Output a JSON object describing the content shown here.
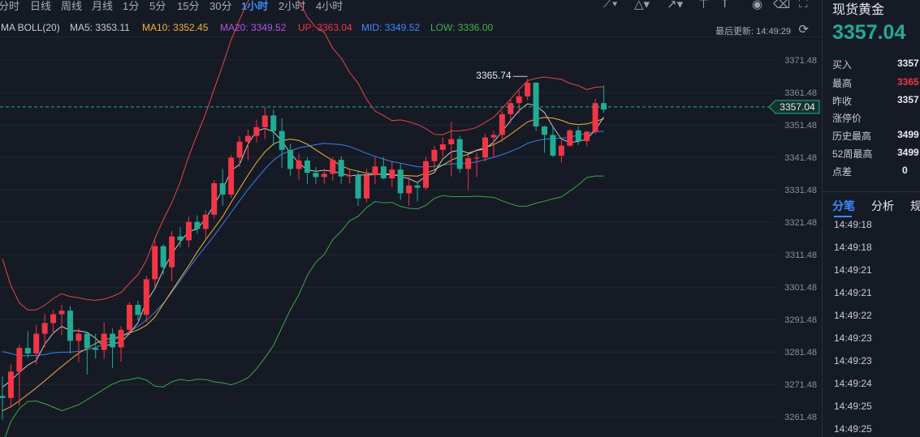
{
  "periods": [
    "分时",
    "日线",
    "周线",
    "月线",
    "1分",
    "5分",
    "15分",
    "30分",
    "1小时",
    "2小时",
    "4小时"
  ],
  "active_period": "1小时",
  "tools": [
    {
      "name": "line-draw-icon",
      "glyph": "⟋"
    },
    {
      "name": "shape-draw-icon",
      "glyph": "△"
    },
    {
      "name": "arrow-draw-icon",
      "glyph": "↗"
    },
    {
      "name": "pin-icon",
      "glyph": "⊤"
    },
    {
      "name": "text-icon",
      "glyph": "T"
    },
    {
      "name": "eye-icon",
      "glyph": "◉"
    },
    {
      "name": "trash-icon",
      "glyph": "🗑"
    },
    {
      "name": "fullscreen-icon",
      "glyph": "⛶"
    }
  ],
  "indicators": {
    "name": "MA BOLL(20)",
    "ma5": "MA5: 3353.11",
    "ma10": "MA10: 3352.45",
    "ma20": "MA20: 3349.52",
    "up": "UP: 3363.04",
    "mid": "MID: 3349.52",
    "low": "LOW: 3336.00"
  },
  "last_update_label": "最后更新: 14:49:29",
  "colors": {
    "up": "#f23645",
    "down": "#22ab94",
    "ma5": "#c9c9c9",
    "ma10": "#f3b432",
    "mid": "#3a7ff0",
    "upband": "#e04848",
    "lowband": "#3fa545",
    "grid": "#222838",
    "bg": "#161a25"
  },
  "sidebar": {
    "title": "现货黄金",
    "price": "3357.04",
    "rows": [
      {
        "label": "买入",
        "value": "3357"
      },
      {
        "label": "最高",
        "value": "3365"
      },
      {
        "label": "昨收",
        "value": "3357"
      },
      {
        "label": "涨停价",
        "value": ""
      },
      {
        "label": "历史最高",
        "value": "3499"
      },
      {
        "label": "52周最高",
        "value": "3499"
      },
      {
        "label": "点差",
        "value": "0"
      }
    ],
    "tabs": [
      "分笔",
      "分析",
      "规"
    ],
    "ticks": [
      "14:49:18",
      "14:49:18",
      "14:49:21",
      "14:49:21",
      "14:49:22",
      "14:49:23",
      "14:49:23",
      "14:49:24",
      "14:49:25",
      "14:49:25"
    ]
  },
  "chart_data": {
    "type": "candlestick",
    "ylim": [
      3256.5,
      3376
    ],
    "y_ticks": [
      "3371.48",
      "3361.48",
      "3351.48",
      "3341.48",
      "3331.48",
      "3321.48",
      "3311.48",
      "3301.48",
      "3291.48",
      "3281.48",
      "3271.48",
      "3261.48"
    ],
    "current_price": "3357.04",
    "max_annotation": "3365.74",
    "candles": [
      [
        3267.9,
        3273.9,
        3260.6,
        3267.3
      ],
      [
        3267.3,
        3277.6,
        3264.3,
        3275.4
      ],
      [
        3275.4,
        3283.7,
        3264.9,
        3282.7
      ],
      [
        3282.7,
        3287.9,
        3279.6,
        3281.0
      ],
      [
        3281.0,
        3289.8,
        3277.6,
        3287.1
      ],
      [
        3287.1,
        3293.3,
        3282.9,
        3290.4
      ],
      [
        3290.4,
        3294.4,
        3287.1,
        3293.1
      ],
      [
        3293.1,
        3296.0,
        3286.7,
        3294.2
      ],
      [
        3294.2,
        3295.6,
        3281.0,
        3284.9
      ],
      [
        3284.9,
        3288.7,
        3278.3,
        3287.1
      ],
      [
        3287.1,
        3287.5,
        3274.5,
        3282.7
      ],
      [
        3282.7,
        3287.1,
        3279.4,
        3282.1
      ],
      [
        3282.1,
        3290.6,
        3279.4,
        3287.1
      ],
      [
        3287.1,
        3288.7,
        3276.5,
        3282.9
      ],
      [
        3282.9,
        3289.4,
        3278.5,
        3288.3
      ],
      [
        3288.3,
        3296.8,
        3286.7,
        3296.0
      ],
      [
        3296.0,
        3297.3,
        3291.3,
        3292.9
      ],
      [
        3292.9,
        3304.9,
        3290.6,
        3303.9
      ],
      [
        3303.9,
        3316.3,
        3301.5,
        3314.1
      ],
      [
        3314.1,
        3314.7,
        3305.3,
        3307.6
      ],
      [
        3307.6,
        3318.8,
        3303.3,
        3317.1
      ],
      [
        3317.1,
        3320.0,
        3313.7,
        3315.9
      ],
      [
        3315.9,
        3323.2,
        3313.7,
        3321.6
      ],
      [
        3321.6,
        3323.6,
        3317.9,
        3319.4
      ],
      [
        3319.4,
        3325.2,
        3316.5,
        3323.8
      ],
      [
        3323.8,
        3334.5,
        3322.6,
        3333.5
      ],
      [
        3333.5,
        3337.9,
        3326.5,
        3330.0
      ],
      [
        3330.0,
        3342.2,
        3329.0,
        3341.4
      ],
      [
        3341.4,
        3348.1,
        3338.5,
        3346.3
      ],
      [
        3346.3,
        3350.0,
        3340.7,
        3348.1
      ],
      [
        3348.1,
        3353.1,
        3346.1,
        3350.8
      ],
      [
        3350.8,
        3357.0,
        3347.1,
        3354.4
      ],
      [
        3354.4,
        3356.2,
        3345.1,
        3349.6
      ],
      [
        3349.6,
        3353.5,
        3338.3,
        3343.8
      ],
      [
        3343.8,
        3345.7,
        3335.8,
        3337.9
      ],
      [
        3337.9,
        3342.6,
        3334.5,
        3340.5
      ],
      [
        3340.5,
        3341.4,
        3333.3,
        3336.7
      ],
      [
        3336.7,
        3338.5,
        3333.3,
        3335.4
      ],
      [
        3335.4,
        3337.9,
        3333.3,
        3336.4
      ],
      [
        3336.4,
        3341.6,
        3334.3,
        3340.7
      ],
      [
        3340.7,
        3341.8,
        3333.3,
        3335.6
      ],
      [
        3335.6,
        3338.1,
        3333.5,
        3336.0
      ],
      [
        3336.0,
        3337.5,
        3326.5,
        3328.8
      ],
      [
        3328.8,
        3337.9,
        3327.7,
        3336.0
      ],
      [
        3336.0,
        3341.6,
        3333.3,
        3338.7
      ],
      [
        3338.7,
        3341.6,
        3334.7,
        3335.0
      ],
      [
        3335.0,
        3340.3,
        3332.3,
        3337.7
      ],
      [
        3337.7,
        3339.7,
        3328.4,
        3330.4
      ],
      [
        3330.4,
        3335.4,
        3326.5,
        3332.8
      ],
      [
        3332.8,
        3333.5,
        3327.9,
        3332.1
      ],
      [
        3332.1,
        3341.6,
        3331.4,
        3340.3
      ],
      [
        3340.3,
        3345.1,
        3337.9,
        3343.8
      ],
      [
        3343.8,
        3347.6,
        3341.8,
        3345.5
      ],
      [
        3345.5,
        3352.4,
        3335.6,
        3347.1
      ],
      [
        3347.1,
        3348.1,
        3336.7,
        3337.9
      ],
      [
        3337.9,
        3342.2,
        3331.4,
        3341.2
      ],
      [
        3341.2,
        3342.9,
        3335.4,
        3341.4
      ],
      [
        3341.4,
        3348.8,
        3340.1,
        3347.6
      ],
      [
        3347.6,
        3349.6,
        3341.4,
        3348.4
      ],
      [
        3348.4,
        3355.8,
        3346.1,
        3354.8
      ],
      [
        3354.8,
        3359.5,
        3352.1,
        3358.2
      ],
      [
        3358.2,
        3362.1,
        3355.2,
        3360.3
      ],
      [
        3360.3,
        3365.7,
        3359.1,
        3364.5
      ],
      [
        3364.5,
        3364.5,
        3349.6,
        3351.0
      ],
      [
        3351.0,
        3351.2,
        3342.9,
        3348.4
      ],
      [
        3348.4,
        3350.8,
        3341.6,
        3342.0
      ],
      [
        3342.0,
        3346.7,
        3339.9,
        3345.1
      ],
      [
        3345.1,
        3350.2,
        3344.7,
        3349.8
      ],
      [
        3349.8,
        3351.0,
        3345.3,
        3346.5
      ],
      [
        3346.5,
        3349.8,
        3344.9,
        3349.4
      ],
      [
        3349.4,
        3359.5,
        3348.6,
        3358.2
      ],
      [
        3358.2,
        3363.6,
        3355.2,
        3356.2
      ]
    ],
    "ma5": [
      3270.6,
      3272.7,
      3275.2,
      3277.4,
      3278.9,
      3283.9,
      3287.3,
      3289.4,
      3288.0,
      3288.0,
      3287.5,
      3285.7,
      3283.1,
      3284.1,
      3284.4,
      3287.2,
      3290.5,
      3297.0,
      3301.0,
      3306.8,
      3311.7,
      3315.5,
      3318.6,
      3319.4,
      3322.6,
      3326.8,
      3331.5,
      3337.4,
      3339.3,
      3345.6,
      3349.6,
      3350.4,
      3349.4,
      3346.5,
      3342.8,
      3339.7,
      3337.6,
      3337.2,
      3337.5,
      3337.2,
      3336.5,
      3335.8,
      3336.0,
      3336.1,
      3336.1,
      3336.5,
      3336.2,
      3335.6,
      3334.9,
      3333.7,
      3335.7,
      3336.8,
      3341.0,
      3343.2,
      3343.7,
      3342.8,
      3343.6,
      3344.1,
      3346.2,
      3349.5,
      3352.8,
      3355.9,
      3358.0,
      3357.4,
      3355.3,
      3350.9,
      3347.1,
      3346.1,
      3346.4,
      3347.1,
      3349.9,
      3353.9
    ],
    "ma10": [
      3263.3,
      3264.6,
      3266.4,
      3268.4,
      3270.4,
      3272.6,
      3274.8,
      3277.0,
      3279.1,
      3281.1,
      3282.6,
      3284.1,
      3285.3,
      3285.7,
      3286.3,
      3287.3,
      3288.3,
      3289.7,
      3292.2,
      3296.3,
      3300.3,
      3304.2,
      3308.1,
      3312.3,
      3316.1,
      3319.6,
      3323.2,
      3327.6,
      3331.8,
      3336.0,
      3339.9,
      3343.2,
      3345.6,
      3346.7,
      3347.1,
      3346.7,
      3345.5,
      3343.8,
      3342.1,
      3340.5,
      3338.9,
      3337.8,
      3337.2,
      3336.6,
      3336.4,
      3336.2,
      3336.1,
      3335.9,
      3335.8,
      3335.7,
      3336.6,
      3337.6,
      3339.1,
      3340.6,
      3341.7,
      3342.4,
      3343.7,
      3344.5,
      3345.4,
      3346.8,
      3348.6,
      3350.5,
      3352.4,
      3353.3,
      3353.8,
      3353.6,
      3352.9,
      3351.9,
      3351.6,
      3351.8,
      3352.5,
      3353.4
    ],
    "mid": [
      3281.6,
      3281.0,
      3280.3,
      3280.3,
      3280.4,
      3280.7,
      3281.2,
      3281.4,
      3281.4,
      3281.7,
      3282.2,
      3282.9,
      3283.9,
      3285.1,
      3286.2,
      3287.8,
      3289.4,
      3291.3,
      3293.7,
      3296.5,
      3299.9,
      3303.5,
      3307.2,
      3310.8,
      3314.0,
      3317.4,
      3320.9,
      3324.5,
      3328.1,
      3331.6,
      3334.8,
      3337.9,
      3340.6,
      3342.5,
      3343.5,
      3344.4,
      3344.9,
      3345.4,
      3345.8,
      3345.6,
      3345.4,
      3344.8,
      3343.8,
      3342.7,
      3341.8,
      3340.9,
      3340.2,
      3339.7,
      3339.1,
      3338.6,
      3338.5,
      3338.7,
      3339.1,
      3339.5,
      3339.5,
      3339.7,
      3340.1,
      3340.8,
      3341.5,
      3342.3,
      3343.3,
      3344.4,
      3345.8,
      3346.6,
      3347.1,
      3347.3,
      3347.4,
      3347.7,
      3348.3,
      3348.8,
      3349.4,
      3349.5
    ]
  }
}
